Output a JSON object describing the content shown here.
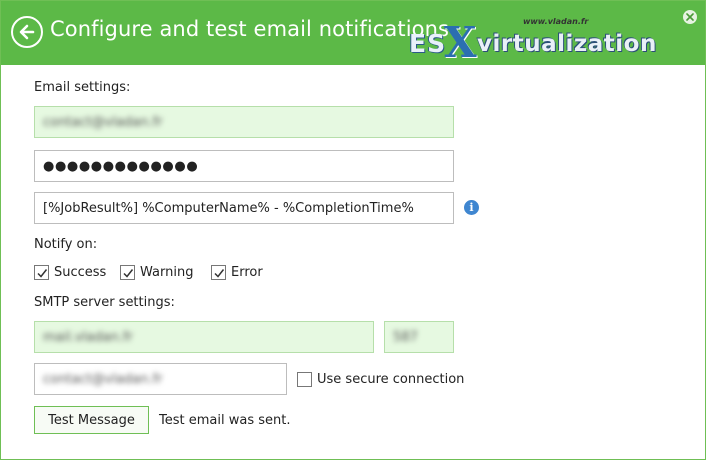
{
  "window": {
    "title": "Configure and test email notifications",
    "accent_color": "#5cb947",
    "watermark": {
      "tagline": "www.vladan.fr",
      "brand_left": "ES",
      "brand_x": "X",
      "brand_right": "virtualization"
    }
  },
  "email": {
    "section_label": "Email settings:",
    "address_value": "contact@vladan.fr",
    "password_value": "●●●●●●●●●●●●●",
    "subject_value": "[%JobResult%] %ComputerName% - %CompletionTime%"
  },
  "notify": {
    "section_label": "Notify on:",
    "options": [
      {
        "label": "Success",
        "checked": true
      },
      {
        "label": "Warning",
        "checked": true
      },
      {
        "label": "Error",
        "checked": true
      }
    ]
  },
  "smtp": {
    "section_label": "SMTP server settings:",
    "server_value": "mail.vladan.fr",
    "port_value": "587",
    "username_value": "contact@vladan.fr",
    "secure_label": "Use secure connection",
    "secure_checked": false
  },
  "test": {
    "button_label": "Test Message",
    "status_text": "Test email was sent."
  },
  "icons": {
    "back": "back-arrow-icon",
    "close": "close-icon",
    "info": "info-icon",
    "check": "checkmark-icon"
  }
}
